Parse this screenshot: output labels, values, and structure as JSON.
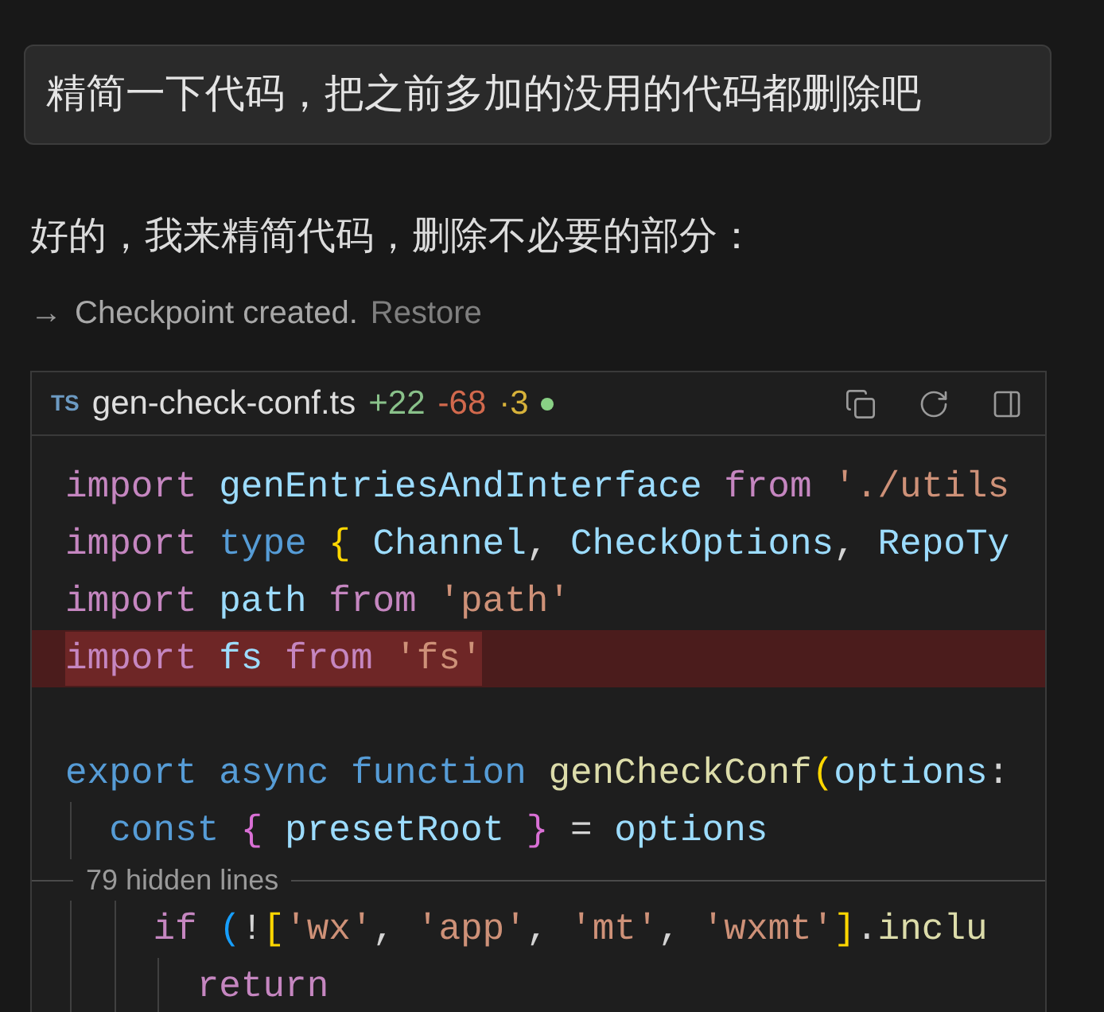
{
  "prompt": {
    "text": "精简一下代码，把之前多加的没用的代码都删除吧"
  },
  "reply": {
    "text": "好的，我来精简代码，删除不必要的部分："
  },
  "checkpoint": {
    "arrow": "→",
    "text": "Checkpoint created.",
    "link": "Restore"
  },
  "code_block": {
    "lang_badge": "TS",
    "filename": "gen-check-conf.ts",
    "added": "+22",
    "removed": "-68",
    "changed": "·3",
    "status_dot": {
      "color": "#89d185"
    },
    "lines": [
      {
        "kind": "code",
        "deleted": false,
        "tokens": [
          {
            "text": "import ",
            "kind": "keyword"
          },
          {
            "text": "genEntriesAndInterface ",
            "kind": "variable"
          },
          {
            "text": "from ",
            "kind": "keyword"
          },
          {
            "text": "'./utils",
            "kind": "string"
          }
        ]
      },
      {
        "kind": "code",
        "deleted": false,
        "tokens": [
          {
            "text": "import ",
            "kind": "keyword"
          },
          {
            "text": "type ",
            "kind": "storage"
          },
          {
            "text": "{ ",
            "kind": "bracket1"
          },
          {
            "text": "Channel",
            "kind": "variable"
          },
          {
            "text": ", ",
            "kind": "punct"
          },
          {
            "text": "CheckOptions",
            "kind": "variable"
          },
          {
            "text": ", ",
            "kind": "punct"
          },
          {
            "text": "RepoTy",
            "kind": "variable"
          }
        ]
      },
      {
        "kind": "code",
        "deleted": false,
        "tokens": [
          {
            "text": "import ",
            "kind": "keyword"
          },
          {
            "text": "path ",
            "kind": "variable"
          },
          {
            "text": "from ",
            "kind": "keyword"
          },
          {
            "text": "'path'",
            "kind": "string"
          }
        ]
      },
      {
        "kind": "code",
        "deleted": true,
        "tokens": [
          {
            "text": "import ",
            "kind": "keyword"
          },
          {
            "text": "fs ",
            "kind": "variable"
          },
          {
            "text": "from ",
            "kind": "keyword"
          },
          {
            "text": "'fs'",
            "kind": "string"
          }
        ]
      },
      {
        "kind": "blank"
      },
      {
        "kind": "code",
        "deleted": false,
        "tokens": [
          {
            "text": "export ",
            "kind": "storage"
          },
          {
            "text": "async ",
            "kind": "storage"
          },
          {
            "text": "function ",
            "kind": "storage"
          },
          {
            "text": "genCheckConf",
            "kind": "function"
          },
          {
            "text": "(",
            "kind": "bracket1"
          },
          {
            "text": "options",
            "kind": "variable"
          },
          {
            "text": ":",
            "kind": "punct"
          }
        ]
      },
      {
        "kind": "code",
        "deleted": false,
        "tokens": [
          {
            "text": "  const ",
            "kind": "storage"
          },
          {
            "text": "{ ",
            "kind": "bracket2"
          },
          {
            "text": "presetRoot ",
            "kind": "variable"
          },
          {
            "text": "} ",
            "kind": "bracket2"
          },
          {
            "text": "= ",
            "kind": "punct"
          },
          {
            "text": "options",
            "kind": "variable"
          }
        ]
      },
      {
        "kind": "hidden",
        "text": "79 hidden lines"
      },
      {
        "kind": "code",
        "deleted": false,
        "tokens": [
          {
            "text": "    if ",
            "kind": "keyword"
          },
          {
            "text": "(",
            "kind": "bracket3"
          },
          {
            "text": "!",
            "kind": "punct"
          },
          {
            "text": "[",
            "kind": "bracket1"
          },
          {
            "text": "'wx'",
            "kind": "string"
          },
          {
            "text": ", ",
            "kind": "punct"
          },
          {
            "text": "'app'",
            "kind": "string"
          },
          {
            "text": ", ",
            "kind": "punct"
          },
          {
            "text": "'mt'",
            "kind": "string"
          },
          {
            "text": ", ",
            "kind": "punct"
          },
          {
            "text": "'wxmt'",
            "kind": "string"
          },
          {
            "text": "]",
            "kind": "bracket1"
          },
          {
            "text": ".",
            "kind": "punct"
          },
          {
            "text": "inclu",
            "kind": "function"
          }
        ]
      },
      {
        "kind": "code",
        "deleted": false,
        "tokens": [
          {
            "text": "      return",
            "kind": "keyword"
          }
        ]
      }
    ]
  }
}
